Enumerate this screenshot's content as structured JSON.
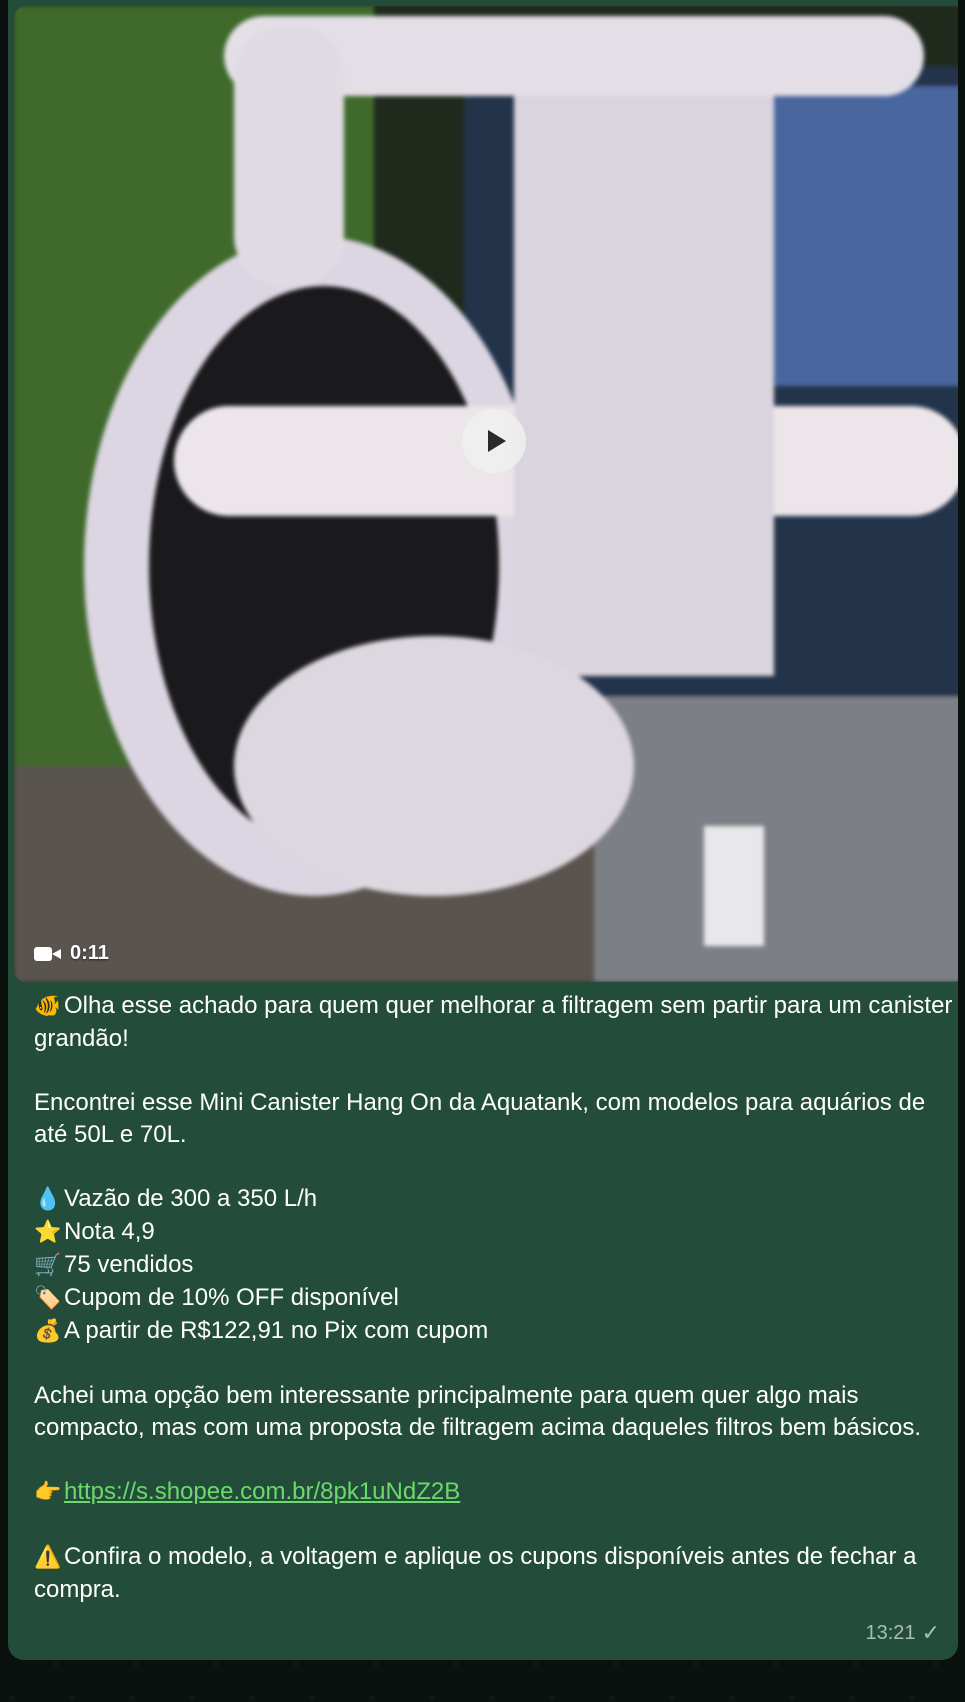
{
  "video": {
    "duration": "0:11"
  },
  "caption": {
    "intro_emoji": "🐠",
    "intro": "Olha esse achado para quem quer melhorar a filtragem sem partir para um canister grandão!",
    "found": "Encontrei esse Mini Canister Hang On da Aquatank, com modelos para aquários de até 50L e 70L.",
    "features": [
      {
        "emoji": "💧",
        "icon": "droplet-icon",
        "text": "Vazão de 300 a 350 L/h"
      },
      {
        "emoji": "⭐",
        "icon": "star-icon",
        "text": "Nota 4,9"
      },
      {
        "emoji": "🛒",
        "icon": "cart-icon",
        "text": "75 vendidos"
      },
      {
        "emoji": "🏷️",
        "icon": "tag-icon",
        "text": "Cupom de 10% OFF disponível"
      },
      {
        "emoji": "💰",
        "icon": "money-bag-icon",
        "text": "A partir de R$122,91 no Pix com cupom"
      }
    ],
    "opinion": "Achei uma opção bem interessante principalmente para quem quer algo mais compacto, mas com uma proposta de filtragem acima daqueles filtros bem básicos.",
    "link_emoji": "👉",
    "link": "https://s.shopee.com.br/8pk1uNdZ2B",
    "warning_emoji": "⚠️",
    "warning": "Confira o modelo, a voltagem e aplique os cupons disponíveis antes de fechar a compra."
  },
  "meta": {
    "time": "13:21",
    "check": "✓"
  },
  "colors": {
    "bubble": "#234d3a",
    "link": "#6bd96b"
  }
}
